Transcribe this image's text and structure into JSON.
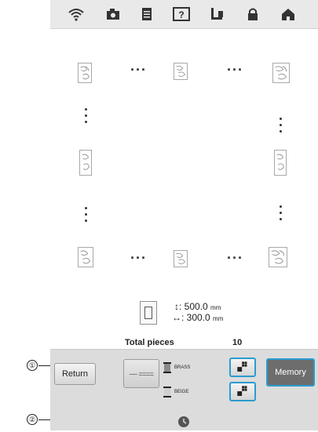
{
  "topbar": {
    "icons": [
      "wifi-icon",
      "camera-icon",
      "document-icon",
      "help-icon",
      "thread-icon",
      "lock-icon",
      "home-icon"
    ]
  },
  "layout_preview": {
    "height_symbol": "↕",
    "width_symbol": "↔",
    "height_value": "500.0",
    "width_value": "300.0",
    "unit": "mm",
    "total_pieces_label": "Total pieces",
    "total_pieces_value": "10"
  },
  "bottom_bar": {
    "return_label": "Return",
    "split_glyph": "---- ====",
    "thread1_label": "BRASS",
    "thread1_color": "#8a8a8a",
    "thread2_label": "BEIGE",
    "thread2_color": "#cfcfcf",
    "memory_label": "Memory"
  },
  "callouts": {
    "one": "①",
    "two": "②"
  },
  "colors": {
    "highlight": "#2a9cd0",
    "memory_bg": "#6d6d6d",
    "bar_bg": "#e9e9e9"
  }
}
